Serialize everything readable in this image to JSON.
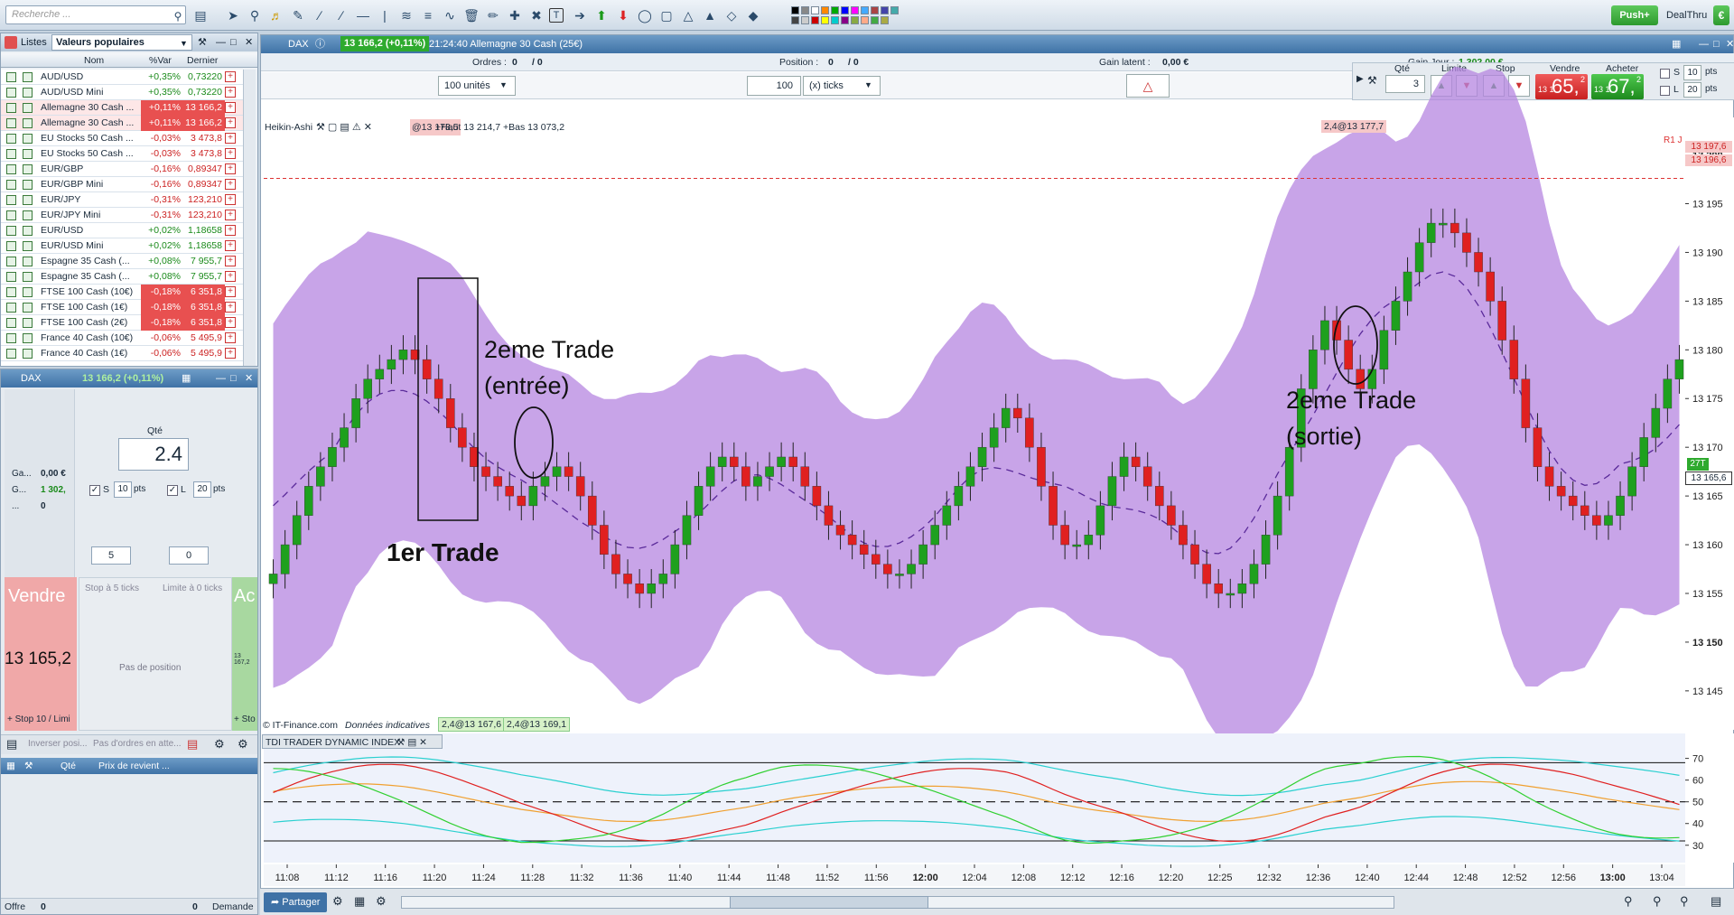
{
  "toolbar": {
    "search_placeholder": "Recherche ...",
    "push_label": "Push+",
    "dealthru_label": "DealThru"
  },
  "watchlist": {
    "tab_label": "Listes",
    "list_name": "Valeurs populaires",
    "col_nom": "Nom",
    "col_var": "%Var",
    "col_last": "Dernier",
    "rows": [
      {
        "name": "AUD/USD",
        "var": "+0,35%",
        "last": "0,73220",
        "dir": "up"
      },
      {
        "name": "AUD/USD Mini",
        "var": "+0,35%",
        "last": "0,73220",
        "dir": "up"
      },
      {
        "name": "Allemagne 30 Cash ...",
        "var": "+0,11%",
        "last": "13 166,2",
        "dir": "hl"
      },
      {
        "name": "Allemagne 30 Cash ...",
        "var": "+0,11%",
        "last": "13 166,2",
        "dir": "hl"
      },
      {
        "name": "EU Stocks 50 Cash ...",
        "var": "-0,03%",
        "last": "3 473,8",
        "dir": "dn"
      },
      {
        "name": "EU Stocks 50 Cash ...",
        "var": "-0,03%",
        "last": "3 473,8",
        "dir": "dn"
      },
      {
        "name": "EUR/GBP",
        "var": "-0,16%",
        "last": "0,89347",
        "dir": "dn"
      },
      {
        "name": "EUR/GBP Mini",
        "var": "-0,16%",
        "last": "0,89347",
        "dir": "dn"
      },
      {
        "name": "EUR/JPY",
        "var": "-0,31%",
        "last": "123,210",
        "dir": "dn"
      },
      {
        "name": "EUR/JPY Mini",
        "var": "-0,31%",
        "last": "123,210",
        "dir": "dn"
      },
      {
        "name": "EUR/USD",
        "var": "+0,02%",
        "last": "1,18658",
        "dir": "up"
      },
      {
        "name": "EUR/USD Mini",
        "var": "+0,02%",
        "last": "1,18658",
        "dir": "up"
      },
      {
        "name": "Espagne 35 Cash (...",
        "var": "+0,08%",
        "last": "7 955,7",
        "dir": "up"
      },
      {
        "name": "Espagne 35 Cash (...",
        "var": "+0,08%",
        "last": "7 955,7",
        "dir": "up"
      },
      {
        "name": "FTSE 100 Cash (10€)",
        "var": "-0,18%",
        "last": "6 351,8",
        "dir": "hld"
      },
      {
        "name": "FTSE 100 Cash (1€)",
        "var": "-0,18%",
        "last": "6 351,8",
        "dir": "hld"
      },
      {
        "name": "FTSE 100 Cash (2€)",
        "var": "-0,18%",
        "last": "6 351,8",
        "dir": "hld"
      },
      {
        "name": "France 40 Cash (10€)",
        "var": "-0,06%",
        "last": "5 495,9",
        "dir": "dn"
      },
      {
        "name": "France 40 Cash (1€)",
        "var": "-0,06%",
        "last": "5 495,9",
        "dir": "dn"
      }
    ]
  },
  "order_panel": {
    "title": "DAX",
    "price_badge": "13 166,2 (+0,11%)",
    "qty_label": "Qté",
    "qty_value": "2.4",
    "ga_label": "Ga...",
    "ga_value": "0,00 €",
    "g_label": "G...",
    "g_value": "1 302,",
    "dots_label": "...",
    "dots_value": "0",
    "s_label": "S",
    "s_value": "10",
    "pts": "pts",
    "l_label": "L",
    "l_value": "20",
    "stepper1": "5",
    "stepper2": "0",
    "sell_label": "Vendre",
    "sell_price": "13 165,2",
    "sell_foot": "+ Stop 10 / Limi",
    "stop_tab": "Stop à 5 ticks",
    "limit_tab": "Limite à 0 ticks",
    "no_position": "Pas de position",
    "buy_label": "Ac",
    "buy_small": "13 167,2",
    "buy_foot": "+ Sto",
    "inverse_pos": "Inverser posi...",
    "no_orders": "Pas d'ordres en atte...",
    "pos_col_qty": "Qté",
    "pos_col_price": "Prix de revient ...",
    "offer_label": "Offre",
    "offer_value": "0",
    "demand_value": "0",
    "demand_label": "Demande"
  },
  "chart_window": {
    "title": "DAX",
    "price_badge": "13 166,2 (+0,11%)",
    "time_instrument": "21:24:40 Allemagne 30 Cash (25€)",
    "orders_label": "Ordres :",
    "orders_value": "0",
    "orders_value2": "/ 0",
    "position_label": "Position :",
    "position_value": "0",
    "position_value2": "/ 0",
    "latent_label": "Gain latent :",
    "latent_value": "0,00 €",
    "day_label": "Gain Jour :",
    "day_value": "1 302,00 €",
    "units_select": "100 unités",
    "ticks_value": "100",
    "ticks_select": "(x) ticks",
    "qte_label": "Qté",
    "qte_value": "3",
    "limite_label": "Limite",
    "stop_label": "Stop",
    "vendre_label": "Vendre",
    "acheter_label": "Acheter",
    "sell_small": "13 1",
    "sell_big": "65,",
    "sell_sup": "2",
    "buy_small": "13 1",
    "buy_big": "67,",
    "buy_sup": "2",
    "s_label": "S",
    "s_value": "10",
    "l_label": "L",
    "l_value": "20",
    "pts": "pts",
    "indicator_name": "Heikin-Ashi",
    "info_text": "+Haut 13 214,7 +Bas 13 073,2",
    "info_overlap": "@13 173,5",
    "order_marker_top": "2,4@13 177,7",
    "r1_label": "R1 J",
    "copyright": "© IT-Finance.com",
    "data_note": "Données indicatives",
    "trade_box1": "2,4@13 167,6",
    "trade_box2": "2,4@13 169,1",
    "tdi_label": "TDI TRADER DYNAMIC INDEX",
    "share_label": "Partager",
    "vol_marker": "27T",
    "current_price": "13 165,6",
    "r1_price": "13 197,6",
    "r1b_price": "13 196,6"
  },
  "annotations": {
    "trade1": "1er Trade",
    "trade2_entry_l1": "2eme Trade",
    "trade2_entry_l2": "(entrée)",
    "trade2_exit_l1": "2eme Trade",
    "trade2_exit_l2": "(sortie)"
  },
  "chart_data": {
    "type": "candlestick",
    "title": "DAX Heikin-Ashi",
    "y_ticks": [
      "13 200",
      "13 195",
      "13 190",
      "13 185",
      "13 180",
      "13 175",
      "13 170",
      "13 165",
      "13 160",
      "13 155",
      "13 150",
      "13 145"
    ],
    "x_ticks": [
      "11:08",
      "11:12",
      "11:16",
      "11:20",
      "11:24",
      "11:28",
      "11:32",
      "11:36",
      "11:40",
      "11:44",
      "11:48",
      "11:52",
      "11:56",
      "12:00",
      "12:04",
      "12:08",
      "12:12",
      "12:16",
      "12:20",
      "12:25",
      "12:32",
      "12:36",
      "12:40",
      "12:44",
      "12:48",
      "12:52",
      "12:56",
      "13:00",
      "13:04"
    ],
    "bold_x_ticks": [
      "12:00",
      "13:00"
    ],
    "ylim": [
      13141,
      13202
    ],
    "close_series": [
      13157,
      13160,
      13163,
      13166,
      13168,
      13170,
      13172,
      13175,
      13177,
      13178,
      13179,
      13180,
      13179,
      13177,
      13175,
      13172,
      13170,
      13168,
      13167,
      13166,
      13165,
      13164,
      13166,
      13167,
      13168,
      13167,
      13165,
      13162,
      13159,
      13157,
      13156,
      13155,
      13156,
      13157,
      13160,
      13163,
      13166,
      13168,
      13169,
      13168,
      13166,
      13167,
      13168,
      13169,
      13168,
      13166,
      13164,
      13162,
      13161,
      13160,
      13159,
      13158,
      13157,
      13157,
      13158,
      13160,
      13162,
      13164,
      13166,
      13168,
      13170,
      13172,
      13174,
      13173,
      13170,
      13166,
      13162,
      13160,
      13160,
      13161,
      13164,
      13167,
      13169,
      13168,
      13166,
      13164,
      13162,
      13160,
      13158,
      13156,
      13155,
      13155,
      13156,
      13158,
      13161,
      13165,
      13170,
      13176,
      13180,
      13183,
      13181,
      13178,
      13176,
      13178,
      13182,
      13185,
      13188,
      13191,
      13193,
      13193,
      13192,
      13190,
      13188,
      13185,
      13181,
      13177,
      13172,
      13168,
      13166,
      13165,
      13164,
      13163,
      13162,
      13163,
      13165,
      13168,
      13171,
      13174,
      13177,
      13179
    ],
    "tdi": {
      "ylim": [
        22,
        74
      ],
      "levels": [
        68,
        50,
        32
      ],
      "ticks": [
        "70",
        "60",
        "50",
        "40",
        "30"
      ]
    }
  }
}
